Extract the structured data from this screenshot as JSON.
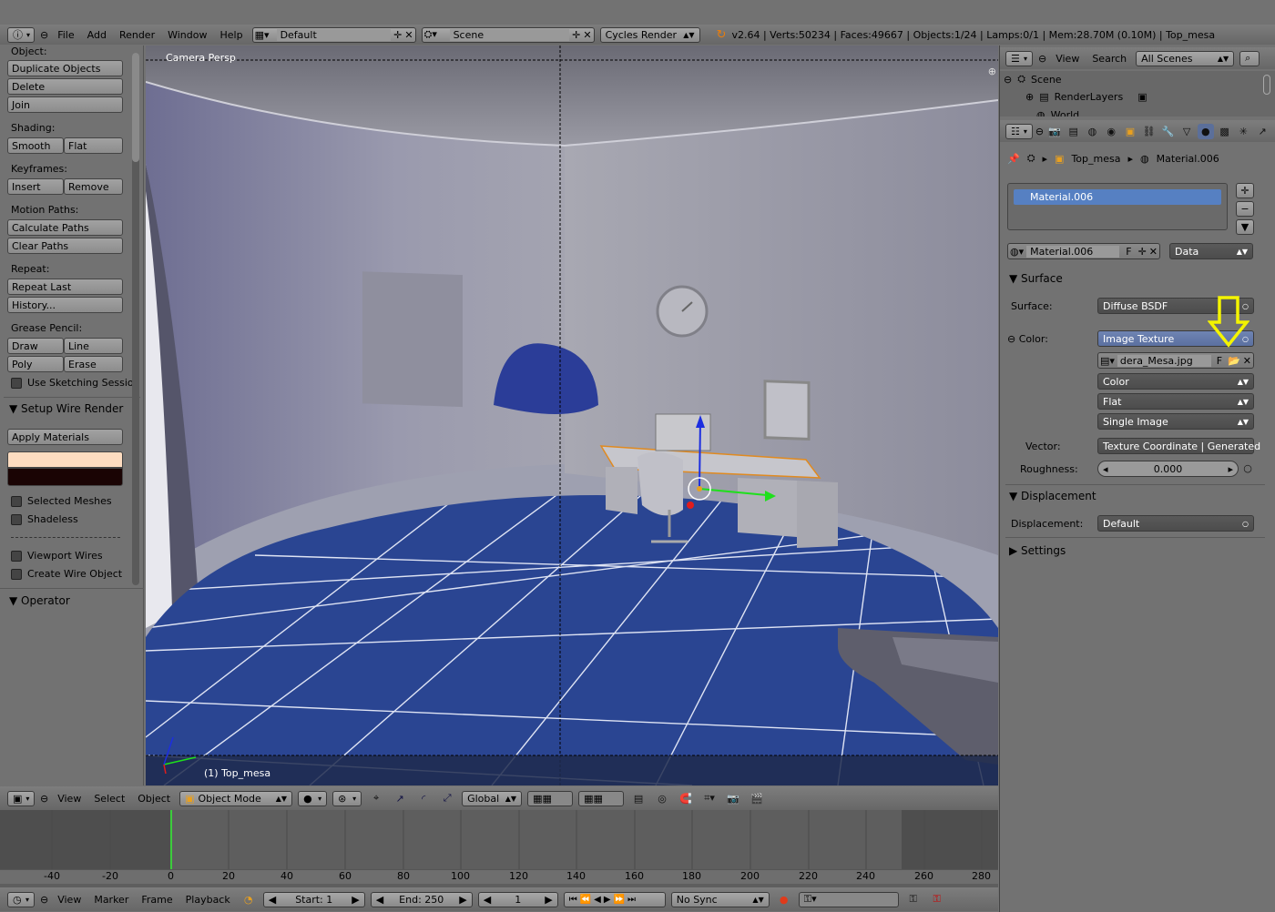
{
  "topbar": {
    "menus": [
      "File",
      "Add",
      "Render",
      "Window",
      "Help"
    ],
    "layout": "Default",
    "scene": "Scene",
    "engine": "Cycles Render",
    "stats": "v2.64 | Verts:50234 | Faces:49667 | Objects:1/24 | Lamps:0/1 | Mem:28.70M (0.10M) | Top_mesa"
  },
  "shelf": {
    "object_label": "Object:",
    "duplicate": "Duplicate Objects",
    "delete": "Delete",
    "join": "Join",
    "shading_label": "Shading:",
    "smooth": "Smooth",
    "flat": "Flat",
    "keyframes_label": "Keyframes:",
    "insert": "Insert",
    "remove": "Remove",
    "motion_label": "Motion Paths:",
    "calc_paths": "Calculate Paths",
    "clear_paths": "Clear Paths",
    "repeat_label": "Repeat:",
    "repeat_last": "Repeat Last",
    "history": "History...",
    "grease_label": "Grease Pencil:",
    "draw": "Draw",
    "line": "Line",
    "poly": "Poly",
    "erase": "Erase",
    "sketching": "Use Sketching Sessio",
    "wire_panel": "Setup Wire Render",
    "apply_materials": "Apply Materials",
    "selected_meshes": "Selected Meshes",
    "shadeless": "Shadeless",
    "viewport_wires": "Viewport Wires",
    "create_wire": "Create Wire Object",
    "operator_panel": "Operator"
  },
  "viewport": {
    "view_label": "Camera Persp",
    "object_label": "(1) Top_mesa"
  },
  "view_header": {
    "menus": [
      "View",
      "Select",
      "Object"
    ],
    "mode": "Object Mode",
    "orientation": "Global"
  },
  "outliner": {
    "menus": [
      "View",
      "Search"
    ],
    "filter": "All Scenes",
    "scene": "Scene",
    "render_layers": "RenderLayers",
    "world": "World"
  },
  "properties": {
    "breadcrumb_obj": "Top_mesa",
    "breadcrumb_mat": "Material.006",
    "slot": "Material.006",
    "mat_name": "Material.006",
    "mat_f": "F",
    "link": "Data",
    "surface_panel": "Surface",
    "surface_label": "Surface:",
    "surface_value": "Diffuse BSDF",
    "color_label": "Color:",
    "color_value": "Image Texture",
    "image_name": "dera_Mesa.jpg",
    "image_f": "F",
    "color_space": "Color",
    "projection": "Flat",
    "source": "Single Image",
    "vector_label": "Vector:",
    "vector_value": "Texture Coordinate | Generated",
    "roughness_label": "Roughness:",
    "roughness_value": "0.000",
    "disp_panel": "Displacement",
    "disp_label": "Displacement:",
    "disp_value": "Default",
    "settings_panel": "Settings"
  },
  "timeline": {
    "ticks": [
      "-40",
      "-20",
      "0",
      "20",
      "40",
      "60",
      "80",
      "100",
      "120",
      "140",
      "160",
      "180",
      "200",
      "220",
      "240",
      "260",
      "280"
    ],
    "menus": [
      "View",
      "Marker",
      "Frame",
      "Playback"
    ],
    "start": "Start: 1",
    "end": "End: 250",
    "current": "1",
    "sync": "No Sync",
    "current_frame": 0
  }
}
